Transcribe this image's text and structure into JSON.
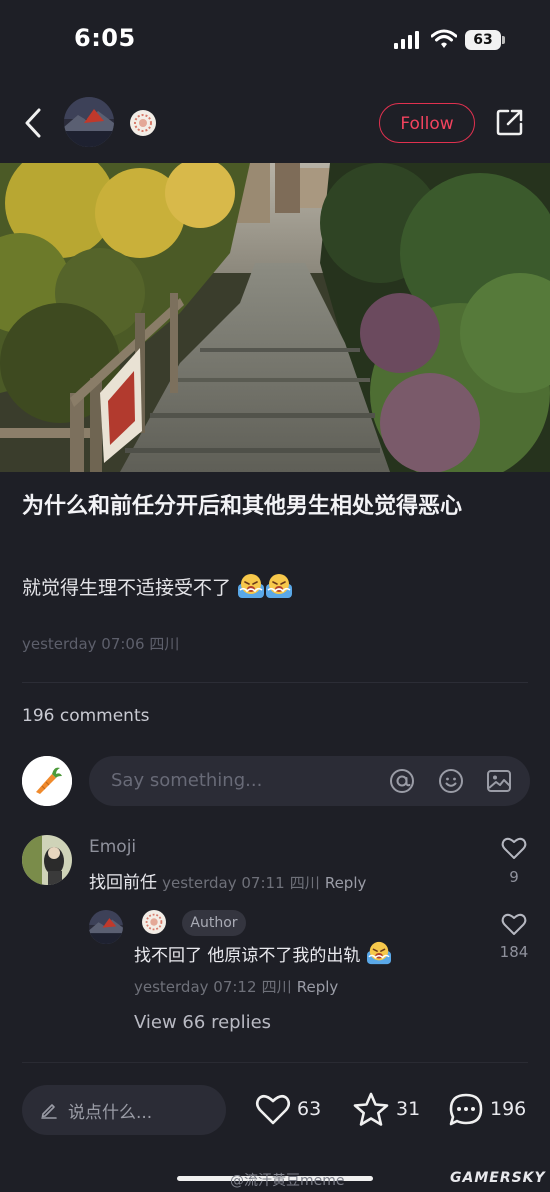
{
  "status_bar": {
    "time": "6:05",
    "battery": "63"
  },
  "header": {
    "follow_label": "Follow"
  },
  "post": {
    "title": "为什么和前任分开后和其他男生相处觉得恶心",
    "body": "就觉得生理不适接受不了",
    "body_emojis": [
      "crying-face",
      "crying-face"
    ],
    "date": "yesterday 07:06",
    "location": "四川"
  },
  "comments_section": {
    "count_label": "196 comments",
    "input_placeholder": "Say something..."
  },
  "comments": [
    {
      "user": "Emoji",
      "text": "找回前任",
      "date": "yesterday 07:11",
      "location": "四川",
      "reply_label": "Reply",
      "likes": "9"
    }
  ],
  "reply": {
    "author_tag": "Author",
    "text": "找不回了 他原谅不了我的出轨",
    "text_emoji": "crying-face",
    "date": "yesterday 07:12",
    "location": "四川",
    "reply_label": "Reply",
    "likes": "184",
    "view_replies": "View 66 replies"
  },
  "bottom_bar": {
    "compose_placeholder": "说点什么...",
    "likes": "63",
    "stars": "31",
    "comments": "196"
  },
  "watermarks": {
    "weibo": "@流汗黄豆meme",
    "site": "GAMERSKY"
  },
  "colors": {
    "background": "#1e1f26",
    "accent": "#e0314f",
    "surface": "#2b2c36"
  }
}
